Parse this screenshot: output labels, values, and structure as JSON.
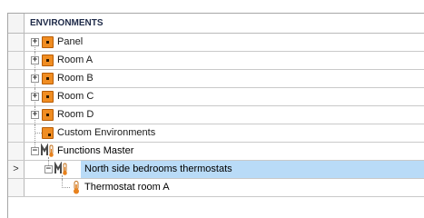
{
  "header": {
    "title": "ENVIRONMENTS"
  },
  "tree": {
    "panel": "Panel",
    "room_a": "Room A",
    "room_b": "Room B",
    "room_c": "Room C",
    "room_d": "Room D",
    "custom_environments": "Custom Environments",
    "functions_master": "Functions Master",
    "north_side": "North side bedrooms thermostats",
    "thermostat_room_a": "Thermostat room A"
  },
  "row_indicator": ">",
  "expander": {
    "collapsed": "+",
    "expanded": "−"
  },
  "colors": {
    "selection": "#b9dbf7",
    "environment_icon": "#f08d22",
    "grid_line": "#c9c9c9"
  },
  "icons": {
    "environment": "orange-square-icon",
    "functions_master": "functions-master-icon",
    "thermostat": "thermometer-icon"
  }
}
